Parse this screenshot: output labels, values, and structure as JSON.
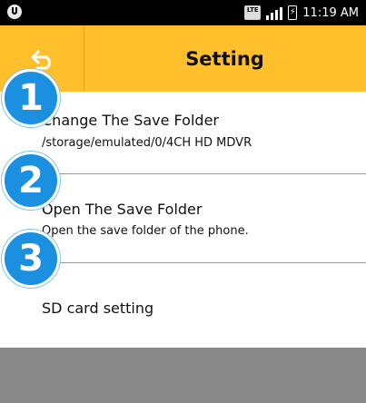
{
  "status_bar": {
    "network_label": "LTE",
    "time": "11:19 AM"
  },
  "header": {
    "title": "Setting"
  },
  "settings": [
    {
      "title": "Change The Save Folder",
      "subtitle": "/storage/emulated/0/4CH HD MDVR"
    },
    {
      "title": "Open The Save Folder",
      "subtitle": "Open the save folder of the phone."
    },
    {
      "title": "SD card setting"
    }
  ],
  "badges": [
    "1",
    "2",
    "3"
  ],
  "colors": {
    "header_bg": "#ffc02b",
    "badge_bg": "#1b8fe0",
    "bottom_bar": "#8a8a8a"
  }
}
